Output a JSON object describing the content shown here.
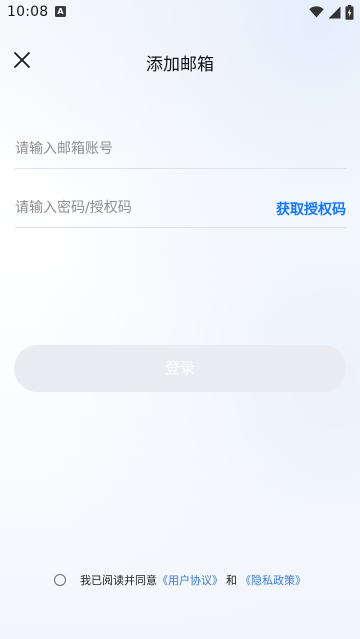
{
  "status_bar": {
    "time": "10:08",
    "notification_icon_letter": "A"
  },
  "header": {
    "title": "添加邮箱"
  },
  "form": {
    "email_placeholder": "请输入邮箱账号",
    "password_placeholder": "请输入密码/授权码",
    "get_auth_code_label": "获取授权码"
  },
  "login": {
    "label": "登录"
  },
  "agreement": {
    "prefix": "我已阅读并同意",
    "user_agreement": "《用户协议》",
    "and": "和",
    "privacy_policy": "《隐私政策》"
  },
  "colors": {
    "accent": "#1677ff",
    "link": "#3b7bd6",
    "button_disabled_bg": "#e9ecf0"
  }
}
